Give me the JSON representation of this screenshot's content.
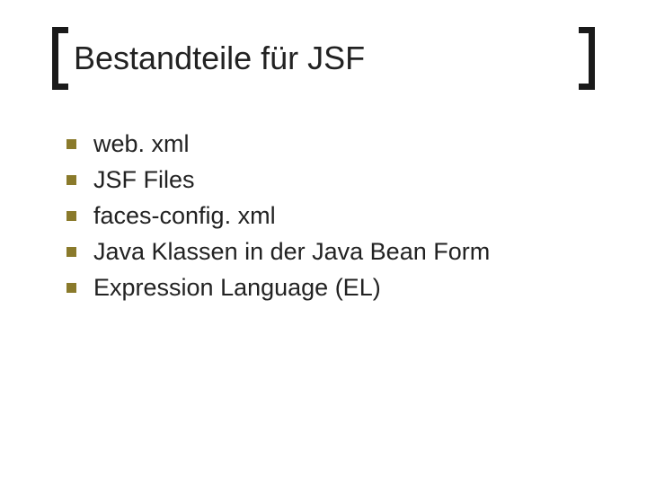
{
  "title": "Bestandteile für JSF",
  "items": [
    "web. xml",
    "JSF Files",
    "faces-config. xml",
    "Java Klassen in der Java Bean Form",
    "Expression Language (EL)"
  ]
}
